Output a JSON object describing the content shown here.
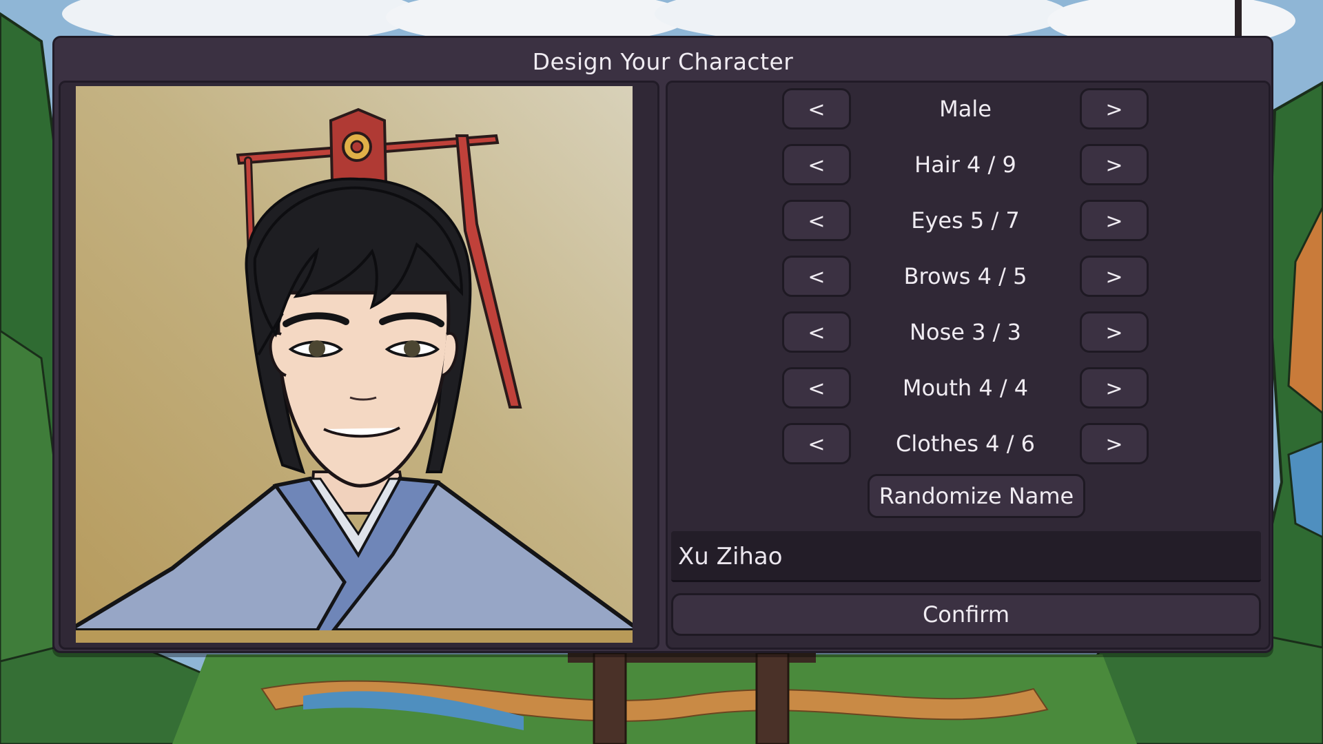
{
  "dialog": {
    "title": "Design Your Character"
  },
  "options": [
    {
      "id": "gender",
      "label": "Male",
      "prev": "<",
      "next": ">"
    },
    {
      "id": "hair",
      "label": "Hair 4 / 9",
      "prev": "<",
      "next": ">"
    },
    {
      "id": "eyes",
      "label": "Eyes 5 / 7",
      "prev": "<",
      "next": ">"
    },
    {
      "id": "brows",
      "label": "Brows 4 / 5",
      "prev": "<",
      "next": ">"
    },
    {
      "id": "nose",
      "label": "Nose 3 / 3",
      "prev": "<",
      "next": ">"
    },
    {
      "id": "mouth",
      "label": "Mouth 4 / 4",
      "prev": "<",
      "next": ">"
    },
    {
      "id": "clothes",
      "label": "Clothes 4 / 6",
      "prev": "<",
      "next": ">"
    }
  ],
  "randomize_label": "Randomize Name",
  "name_value": "Xu Zihao",
  "confirm_label": "Confirm",
  "colors": {
    "panel": "#3b3142",
    "panel_dark": "#302836",
    "border": "#211b27",
    "text": "#f0ecf2",
    "robe": "#97a6c6",
    "hat": "#c0413a"
  }
}
